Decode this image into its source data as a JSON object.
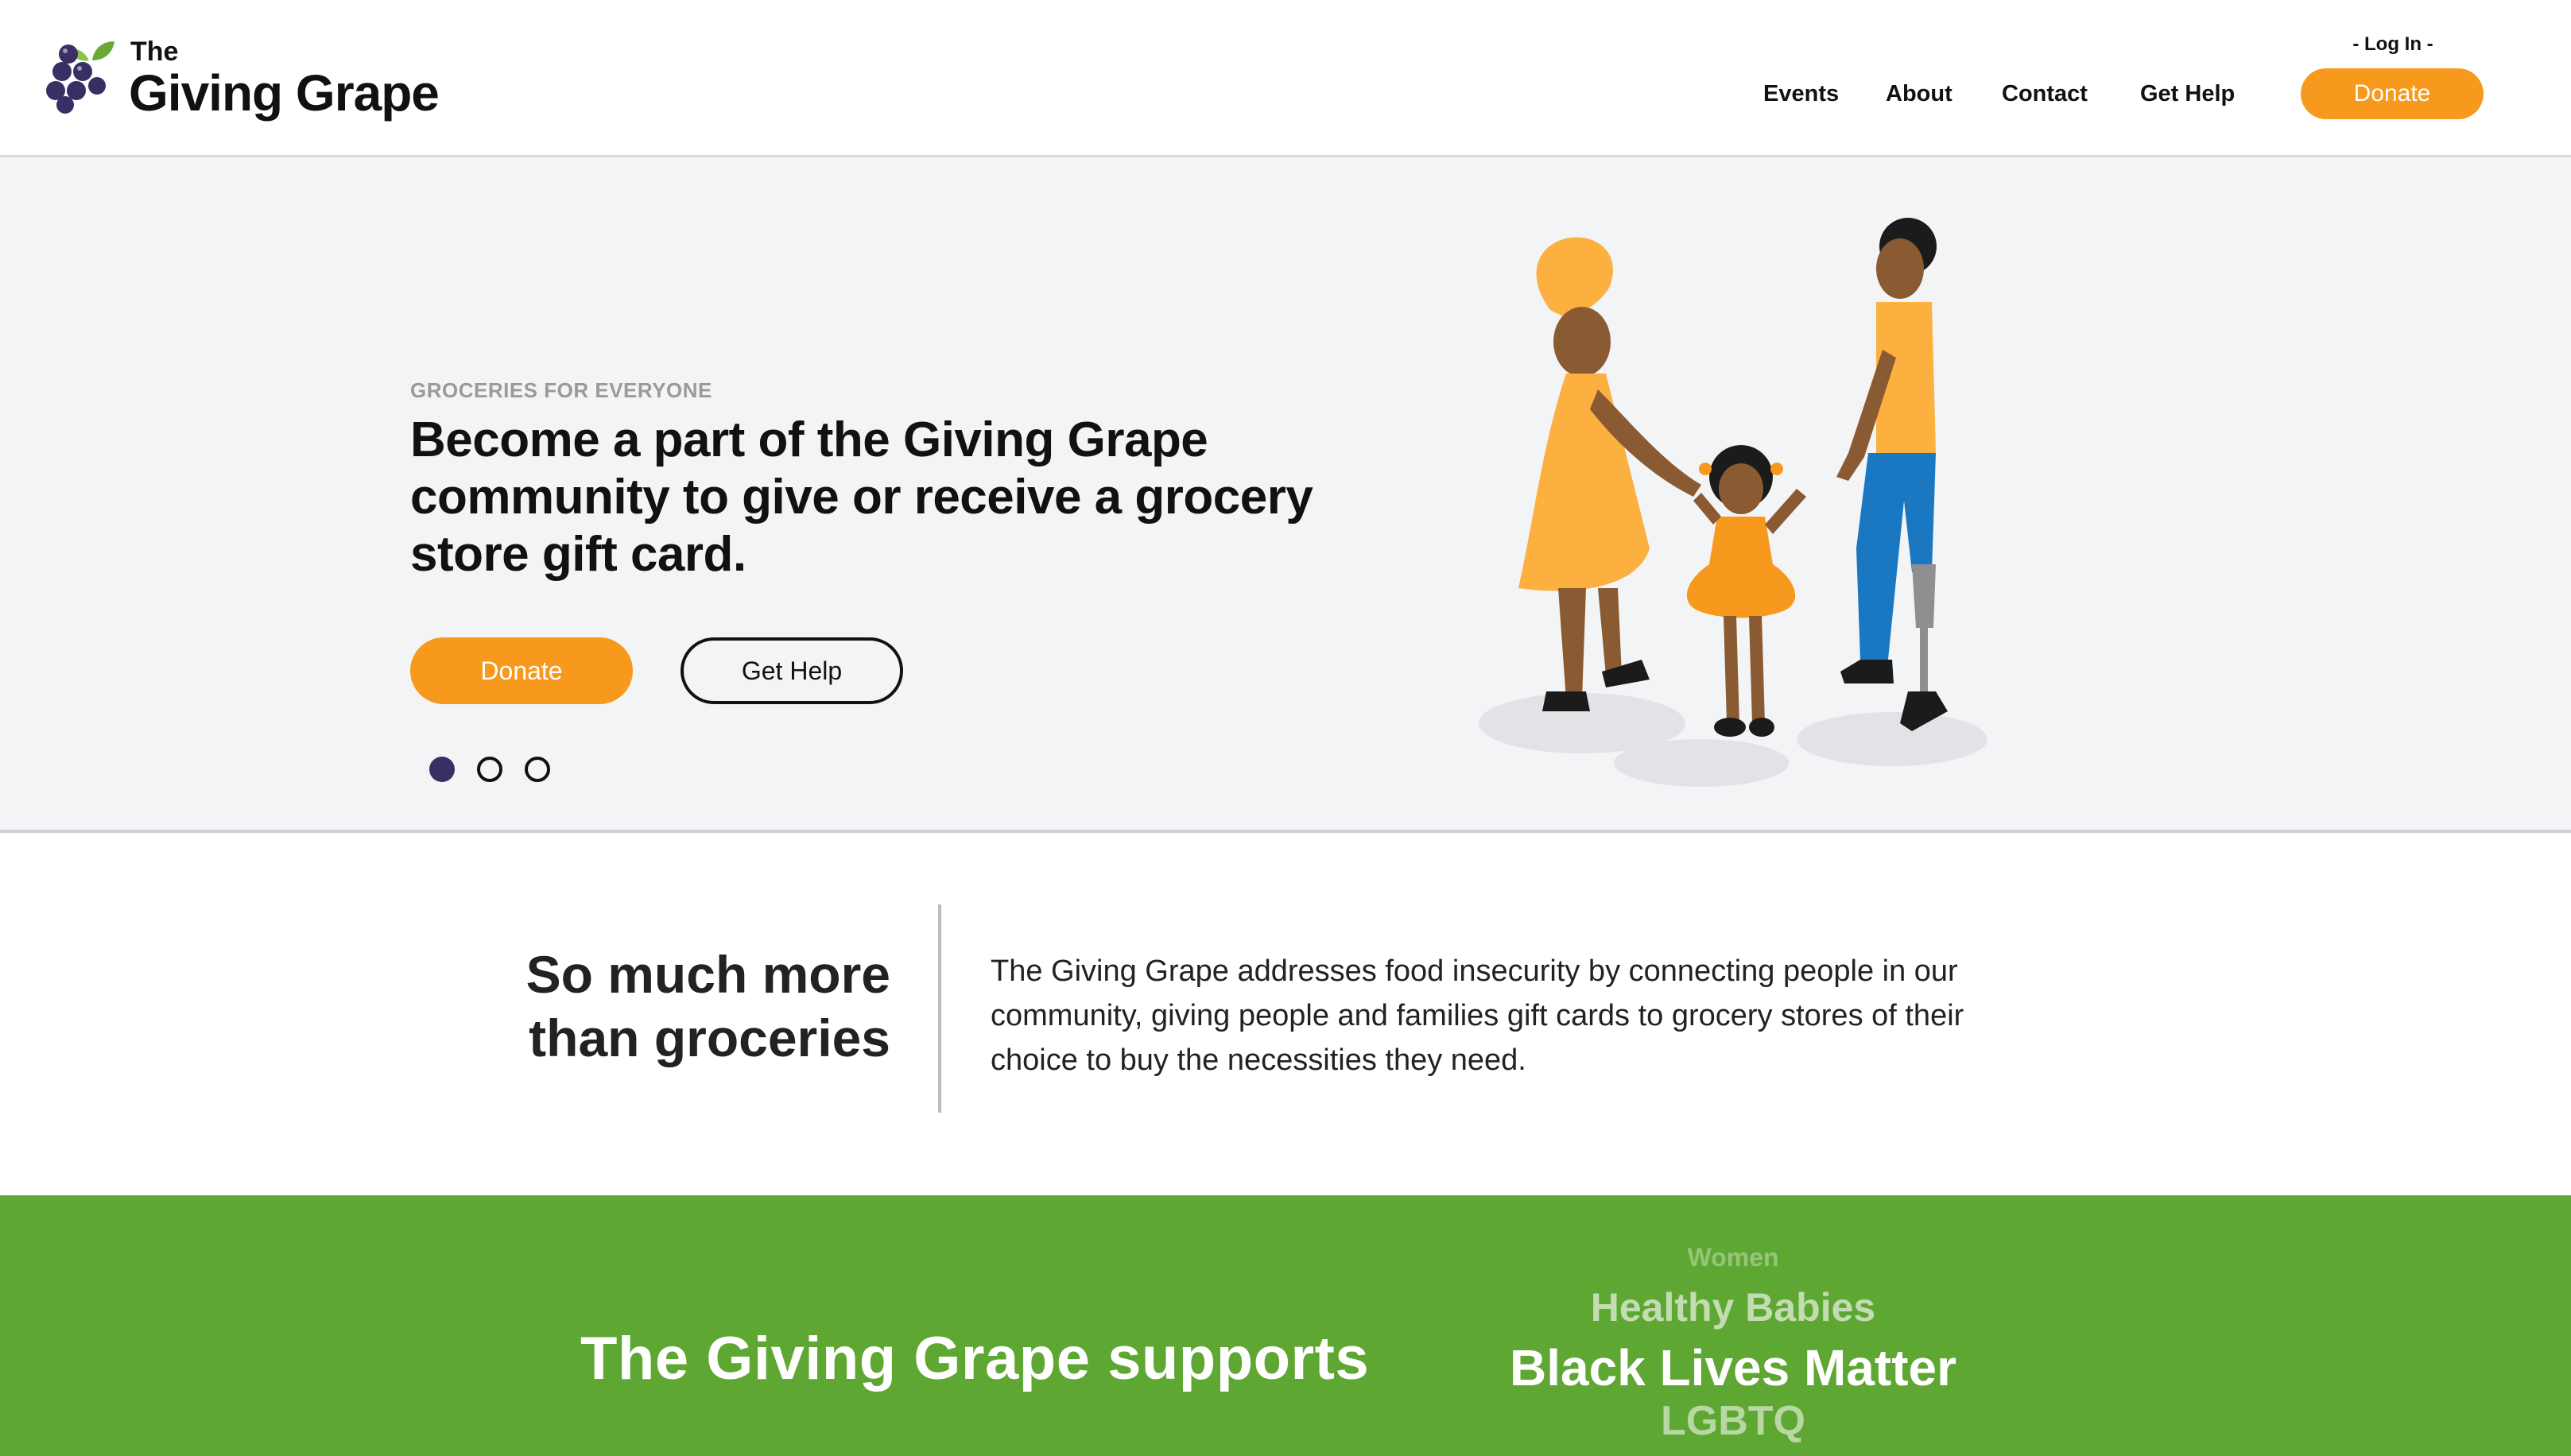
{
  "header": {
    "logo_the": "The",
    "logo_name": "Giving Grape",
    "nav": [
      {
        "label": "Events"
      },
      {
        "label": "About"
      },
      {
        "label": "Contact"
      },
      {
        "label": "Get Help"
      }
    ],
    "login_label": "- Log In -",
    "donate_label": "Donate"
  },
  "hero": {
    "eyebrow": "GROCERIES FOR EVERYONE",
    "headline": "Become a part of the Giving Grape community to give or receive a grocery store gift card.",
    "donate_label": "Donate",
    "gethelp_label": "Get Help",
    "slides_count": 3,
    "active_slide": 1
  },
  "about": {
    "title_line1": "So much more",
    "title_line2": "than groceries",
    "text": "The Giving Grape addresses food insecurity by connecting people in our community, giving people and families gift cards to grocery stores of their choice to buy the necessities they need."
  },
  "supports": {
    "title": "The Giving Grape supports",
    "causes": [
      "Women",
      "Healthy Babies",
      "Black Lives Matter",
      "LGBTQ"
    ]
  },
  "colors": {
    "accent_orange": "#f7991c",
    "brand_green": "#5fa733",
    "grape_purple": "#3a2f64",
    "hero_bg": "#f3f4f6"
  }
}
